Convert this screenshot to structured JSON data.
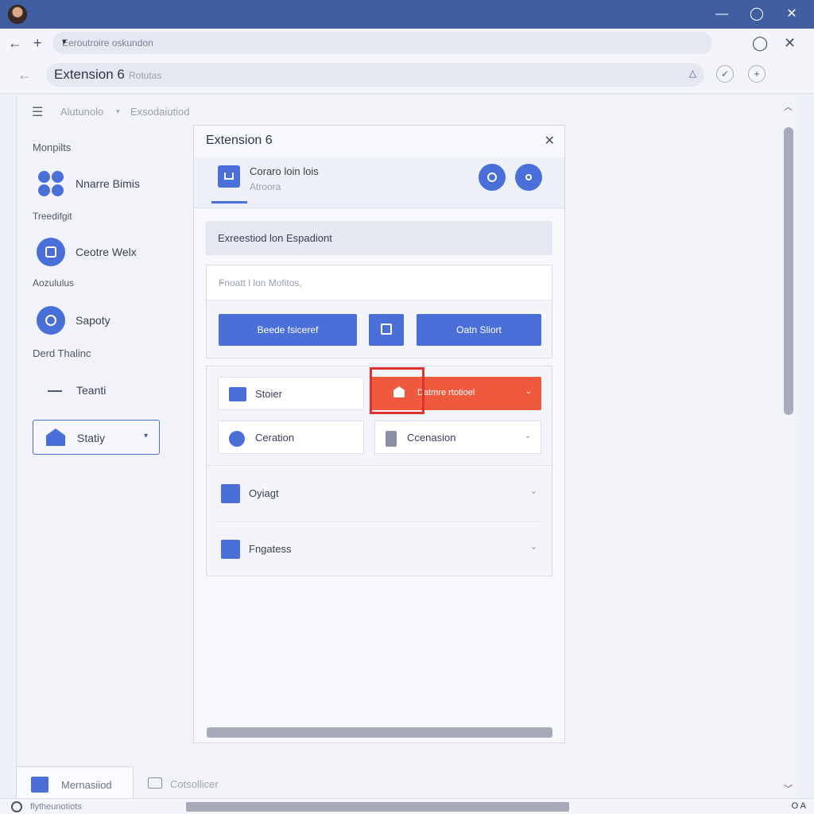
{
  "window": {
    "minimize_glyph": "—",
    "maximize_glyph": "◯",
    "close_glyph": "✕"
  },
  "tabbar": {
    "back_glyph": "←",
    "new_tab_glyph": "+",
    "url_text": "Eeroutroire oskundon",
    "url_dropdown_glyph": "▾",
    "maximize_glyph": "◯",
    "close_glyph": "✕"
  },
  "address": {
    "back_glyph": "←",
    "page_name": "Extension 6",
    "page_suffix": "Rotutas",
    "action_glyph": "△",
    "ext_glyph": "✓",
    "add_glyph": "+"
  },
  "breadcrumb": {
    "menu_glyph": "☰",
    "item1": "Alutunolo",
    "separator": "▾",
    "item2": "Exsodaiutiod"
  },
  "sidebar": {
    "headings": [
      "Monpilts",
      "Treedifgit",
      "Aozululus",
      "Derd Thalinc"
    ],
    "items": [
      {
        "label": "Nnarre Bimis",
        "icon": "cluster-icon"
      },
      {
        "label": "Ceotre Welx",
        "icon": "briefcase-icon"
      },
      {
        "label": "Sapoty",
        "icon": "pin-icon"
      }
    ],
    "dash_item": "Teanti",
    "select": {
      "label": "Statiy",
      "caret": "▾"
    }
  },
  "dialog": {
    "title": "Extension 6",
    "close_glyph": "✕",
    "header_title": "Coraro loin lois",
    "header_subtitle": "Atroora",
    "section_title": "Exreestiod lon Espadiont",
    "field_placeholder": "Fnoatt l lon Mofitos,",
    "field_chevron": "⌄",
    "button_primary": "Beede fsiceref",
    "button_secondary": "Oatn Sliort",
    "options": [
      {
        "label": "Stoier",
        "icon": "folder-icon"
      },
      {
        "label": "Datmre rtotioel",
        "icon": "lock-icon",
        "chevron": "⌄"
      },
      {
        "label": "Ceration",
        "icon": "shield-icon"
      },
      {
        "label": "Ccenasion",
        "icon": "doc-icon",
        "chevron": "⌄"
      }
    ],
    "rows": [
      {
        "label": "Oyiagt",
        "chevron": "⌄"
      },
      {
        "label": "Fngatess",
        "chevron": "⌄"
      }
    ]
  },
  "bottom_tabs": [
    {
      "label": "Mernasiiod"
    },
    {
      "label": "Cotsollicer"
    }
  ],
  "statusbar": {
    "text": "flytheunotiots",
    "right": "O A"
  },
  "colors": {
    "accent": "#4a6fd9",
    "titlebar": "#3f5fa0",
    "danger": "#ef5a3f",
    "focus": "#e0312f"
  }
}
